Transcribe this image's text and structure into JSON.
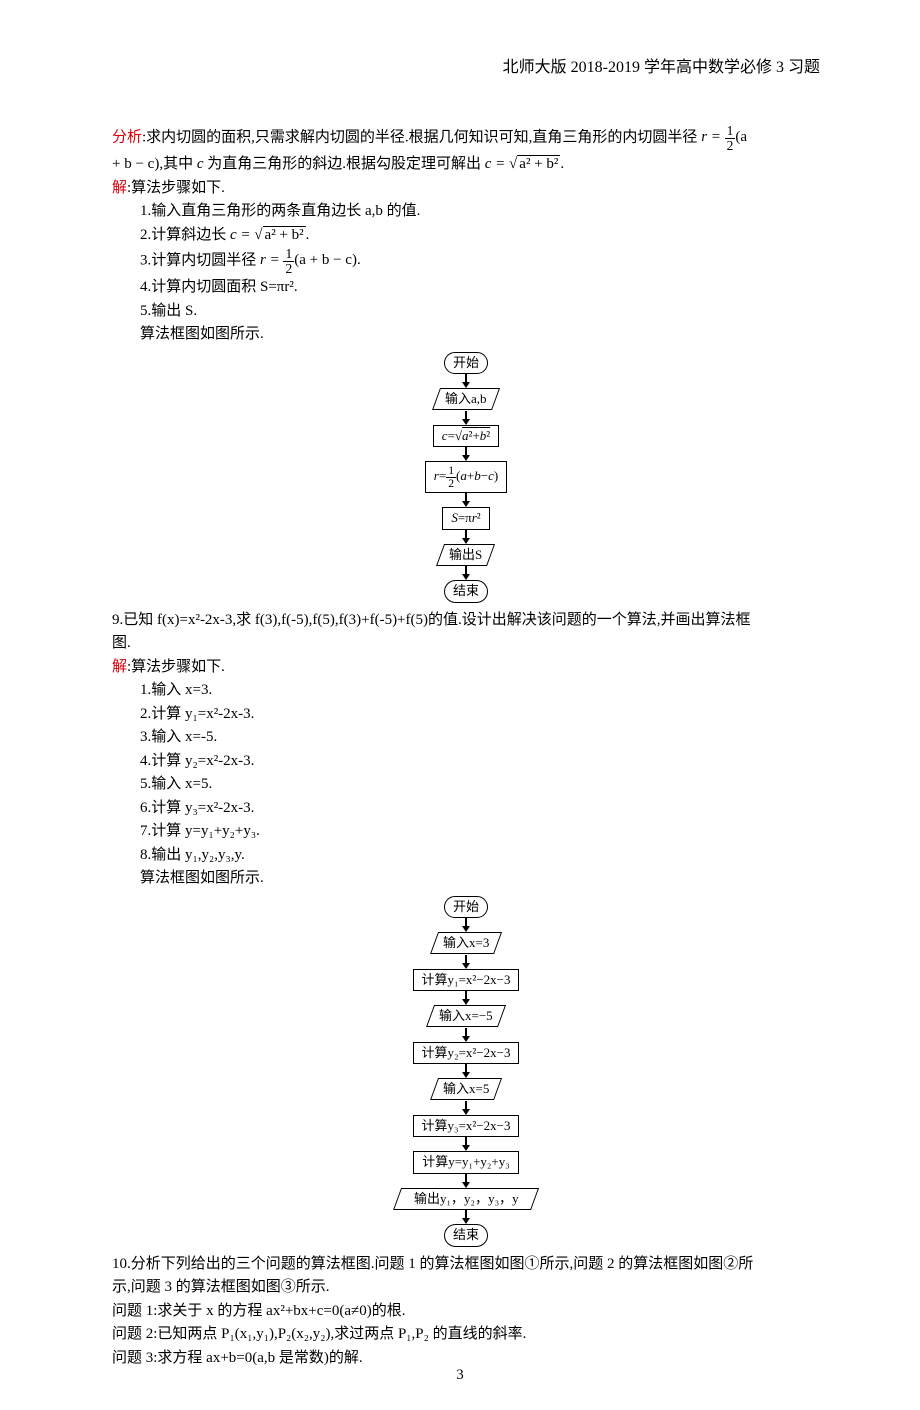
{
  "header": "北师大版 2018-2019 学年高中数学必修 3 习题",
  "analysis_label": "分析",
  "analysis_text_1": ":求内切圆的面积,只需求解内切圆的半径.根据几何知识可知,直角三角形的内切圆半径 ",
  "analysis_eq_r_prefix": "r = ",
  "analysis_eq_r_suffix": "(a",
  "analysis_line2_a": " + b − c),其中 ",
  "analysis_line2_b": "c",
  "analysis_line2_c": " 为直角三角形的斜边.根据勾股定理可解出 ",
  "analysis_eq_c": "c = ",
  "analysis_sqrt_inner": "a² + b²",
  "sol_label": "解",
  "sol_intro": ":算法步骤如下.",
  "steps8": {
    "s1": "1.输入直角三角形的两条直角边长 a,b 的值.",
    "s2a": "2.计算斜边长 ",
    "s2b": "c = ",
    "s3a": "3.计算内切圆半径 ",
    "s3b": "r = ",
    "s3c": "(a + b − c).",
    "s4": "4.计算内切圆面积 S=πr².",
    "s5": "5.输出 S.",
    "fignote": "算法框图如图所示."
  },
  "fc1": {
    "n1": "开始",
    "n2": "输入a,b",
    "n3": "c=√(a²+b²)",
    "n4": "r=½(a+b−c)",
    "n5": "S=πr²",
    "n6": "输出S",
    "n7": "结束"
  },
  "q9_text_a": "9.已知 f(x)=x²-2x-3,求 f(3),f(-5),f(5),f(3)+f(-5)+f(5)的值.设计出解决该问题的一个算法,并画出算法框",
  "q9_text_b": "图.",
  "sol9_intro": ":算法步骤如下.",
  "steps9": {
    "s1": "1.输入 x=3.",
    "s2": "2.计算 y₁=x²-2x-3.",
    "s3": "3.输入 x=-5.",
    "s4": "4.计算 y₂=x²-2x-3.",
    "s5": "5.输入 x=5.",
    "s6": "6.计算 y₃=x²-2x-3.",
    "s7": "7.计算 y=y₁+y₂+y₃.",
    "s8": "8.输出 y₁,y₂,y₃,y.",
    "fignote": "算法框图如图所示."
  },
  "fc2": {
    "n1": "开始",
    "n2": "输入x=3",
    "n3": "计算y₁=x²−2x−3",
    "n4": "输入x=−5",
    "n5": "计算y₂=x²−2x−3",
    "n6": "输入x=5",
    "n7": "计算y₃=x²−2x−3",
    "n8": "计算y=y₁+y₂+y₃",
    "n9": "输出y₁，y₂，y₃，y",
    "n10": "结束"
  },
  "q10_l1": "10.分析下列给出的三个问题的算法框图.问题 1 的算法框图如图①所示,问题 2 的算法框图如图②所",
  "q10_l2": "示,问题 3 的算法框图如图③所示.",
  "q10_p1": "问题 1:求关于 x 的方程 ax²+bx+c=0(a≠0)的根.",
  "q10_p2": "问题 2:已知两点 P₁(x₁,y₁),P₂(x₂,y₂),求过两点 P₁,P₂ 的直线的斜率.",
  "q10_p3": "问题 3:求方程 ax+b=0(a,b 是常数)的解.",
  "page_number": "3"
}
